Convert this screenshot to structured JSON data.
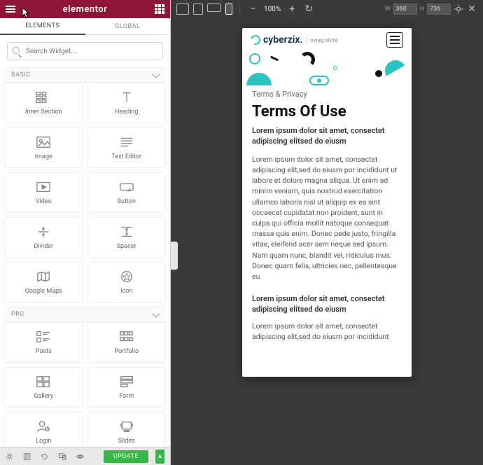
{
  "brand": "elementor",
  "tabs": {
    "elements": "ELEMENTS",
    "global": "GLOBAL"
  },
  "search": {
    "placeholder": "Search Widget..."
  },
  "sections": {
    "basic": "BASIC",
    "pro": "PRO"
  },
  "widgets_basic": [
    {
      "label": "Inner Section"
    },
    {
      "label": "Heading"
    },
    {
      "label": "Image"
    },
    {
      "label": "Text Editor"
    },
    {
      "label": "Video"
    },
    {
      "label": "Button"
    },
    {
      "label": "Divider"
    },
    {
      "label": "Spacer"
    },
    {
      "label": "Google Maps"
    },
    {
      "label": "Icon"
    }
  ],
  "widgets_pro": [
    {
      "label": "Posts"
    },
    {
      "label": "Portfolio"
    },
    {
      "label": "Gallery"
    },
    {
      "label": "Form"
    },
    {
      "label": "Login"
    },
    {
      "label": "Slides"
    }
  ],
  "footer": {
    "update": "UPDATE"
  },
  "toolbar": {
    "zoom": "100%",
    "w_label": "W",
    "h_label": "H",
    "w": "360",
    "h": "736"
  },
  "preview": {
    "logo_text": "cyberzix.",
    "logo_sub": "swag store",
    "crumb": "Terms & Privacy",
    "h1": "Terms Of Use",
    "lead": "Lorem ipsum dolor sit amet, consectet adipiscing elitsed do eiusm",
    "para": "Lorem ipsum dolor sit amet, consectet adipiscing elit,sed do eiusm por incididunt ut labore et dolore magna aliqua. Ut enim ad minim veniam, quis nostrud exercitation ullamco laboris nisi ut aliquip ex ea sint occaecat cupidatat non proident, sunt in culpa qui officia mollit natoque consequat massa quis enim. Donec pede justo, fringilla vitae, eleifend acer sem neque sed ipsum. Nam quam nunc, blandit vel, ridiculus mus. Donec quam felis, ultricies nec, pellentesque eu",
    "lead2": "Lorem ipsum dolor sit amet, consectet adipiscing elitsed do eiusm",
    "para2": "Lorem ipsum dolor sit amet, consectet adipiscing elit,sed do eiusm por incididunt"
  }
}
